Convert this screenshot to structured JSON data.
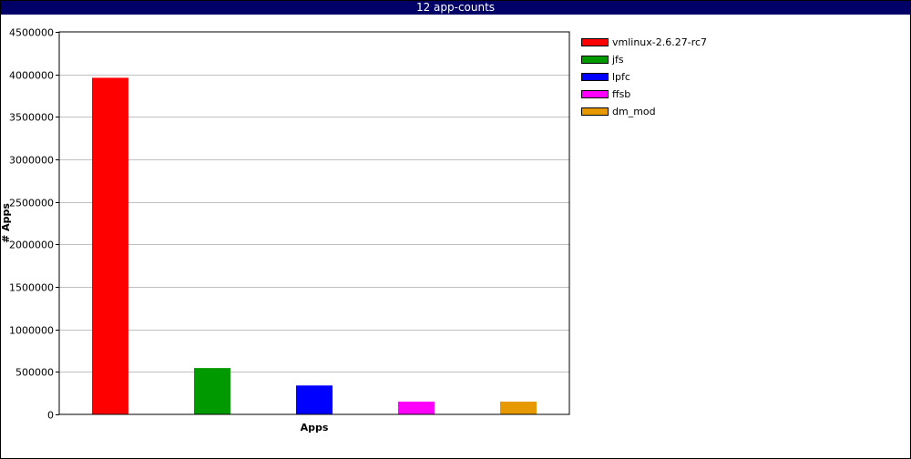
{
  "window": {
    "title": "12 app-counts"
  },
  "chart_data": {
    "type": "bar",
    "title": "12 app-counts",
    "xlabel": "Apps",
    "ylabel": "# Apps",
    "ylim": [
      0,
      4500000
    ],
    "yticks": [
      0,
      500000,
      1000000,
      1500000,
      2000000,
      2500000,
      3000000,
      3500000,
      4000000,
      4500000
    ],
    "grid": true,
    "legend_position": "right",
    "categories": [
      "vmlinux-2.6.27-rc7",
      "jfs",
      "lpfc",
      "ffsb",
      "dm_mod"
    ],
    "values": [
      3960000,
      545000,
      340000,
      150000,
      150000
    ],
    "colors": [
      "#ff0000",
      "#009900",
      "#0000ff",
      "#ff00ff",
      "#e69900"
    ]
  }
}
